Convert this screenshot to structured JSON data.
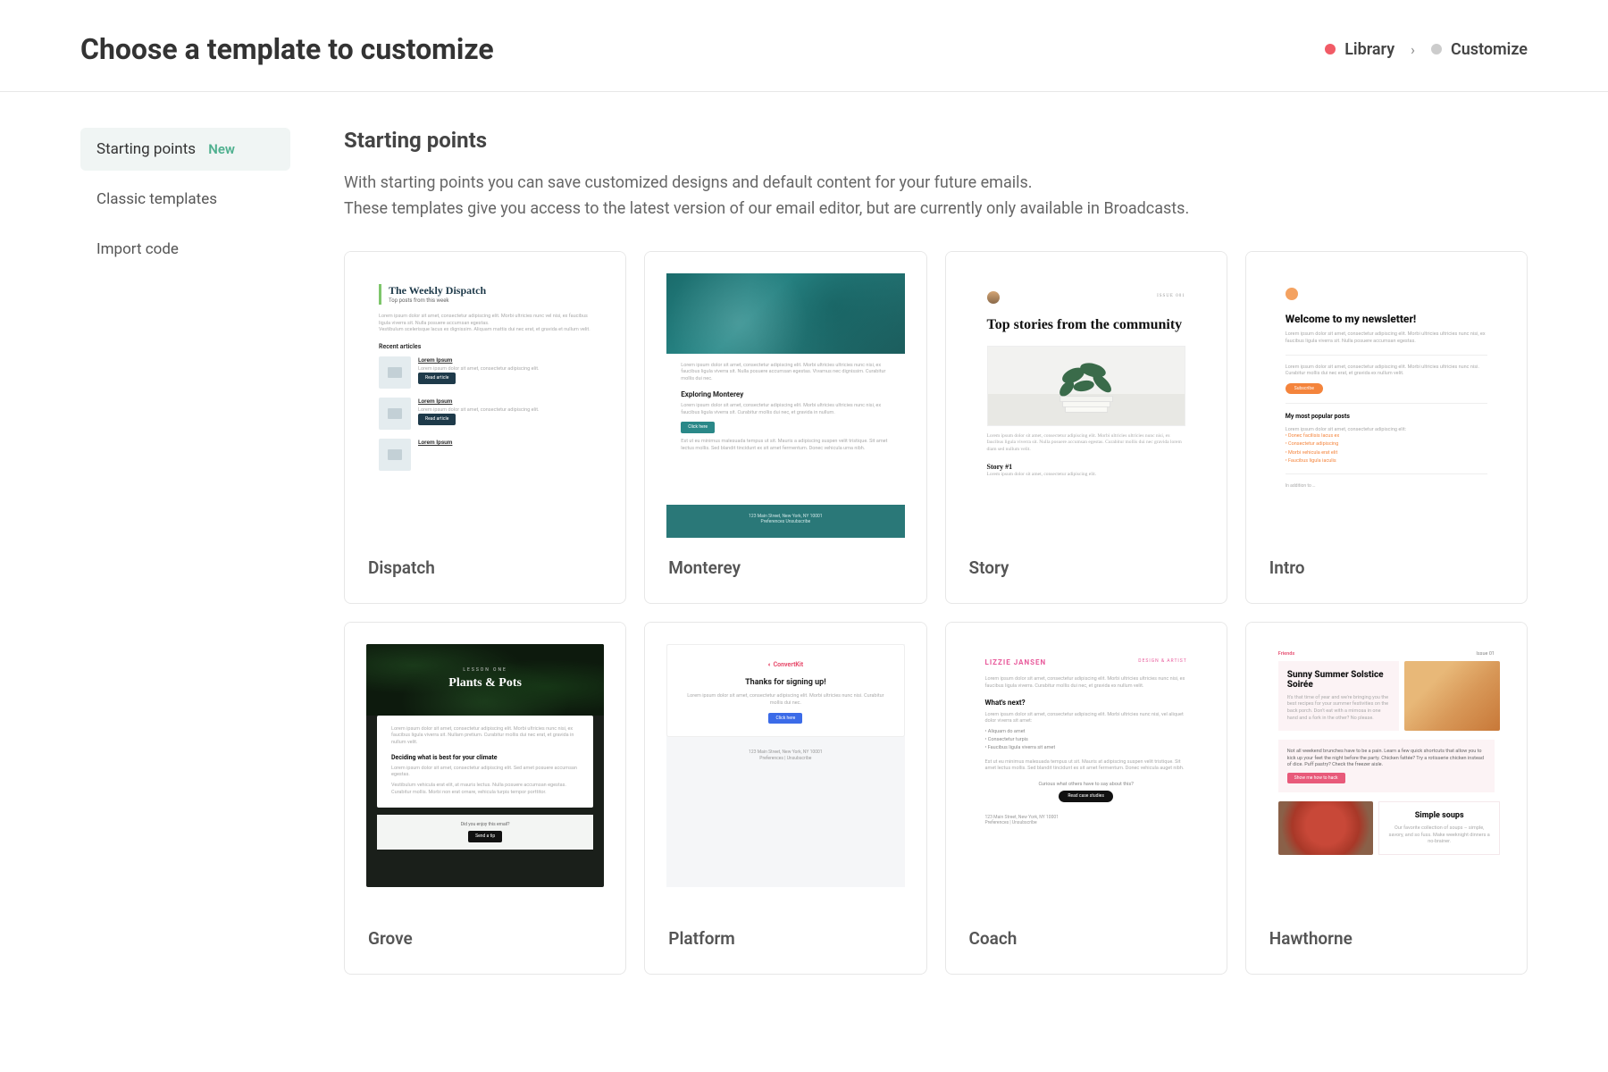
{
  "header": {
    "title": "Choose a template to customize",
    "breadcrumb": [
      {
        "label": "Library",
        "active": true
      },
      {
        "label": "Customize",
        "active": false
      }
    ]
  },
  "sidebar": {
    "items": [
      {
        "label": "Starting points",
        "badge": "New",
        "active": true
      },
      {
        "label": "Classic templates",
        "active": false
      },
      {
        "label": "Import code",
        "active": false
      }
    ]
  },
  "section": {
    "title": "Starting points",
    "desc_line1": "With starting points you can save customized designs and default content for your future emails.",
    "desc_line2": "These templates give you access to the latest version of our email editor, but are currently only available in Broadcasts."
  },
  "templates": [
    {
      "name": "Dispatch"
    },
    {
      "name": "Monterey"
    },
    {
      "name": "Story"
    },
    {
      "name": "Intro"
    },
    {
      "name": "Grove"
    },
    {
      "name": "Platform"
    },
    {
      "name": "Coach"
    },
    {
      "name": "Hawthorne"
    }
  ],
  "mock": {
    "dispatch": {
      "title": "The Weekly Dispatch",
      "subtitle": "Top posts from this week",
      "recent": "Recent articles",
      "item_title": "Lorem Ipsum",
      "read": "Read article"
    },
    "monterey": {
      "heading": "Exploring Monterey",
      "button": "Click here",
      "footer1": "123 Main Street, New York, NY 10001",
      "footer2": "Preferences    Unsubscribe"
    },
    "story": {
      "date": "ISSUE 001",
      "title": "Top stories from the community",
      "story1": "Story #1"
    },
    "intro": {
      "title": "Welcome to my newsletter!",
      "button": "Subscribe",
      "popular": "My most popular posts",
      "links": [
        "Donec facilisis lacus ex",
        "Consectetur adipiscing",
        "Morbi vehicula erat elit",
        "Faucibus ligula iaculis"
      ]
    },
    "grove": {
      "eyebrow": "LESSON ONE",
      "title": "Plants & Pots",
      "h2": "Deciding what is best for your climate",
      "foot": "Did you enjoy this email?",
      "button": "Send a tip"
    },
    "platform": {
      "logo": "ConvertKit",
      "title": "Thanks for signing up!",
      "button": "Click here",
      "foot1": "123 Main Street, New York, NY 10001",
      "foot2": "Preferences   |   Unsubscribe"
    },
    "coach": {
      "name": "LIZZIE JANSEN",
      "role": "DESIGN & ARTIST",
      "h2a": "What's next?",
      "bullets": [
        "Aliquam do amet",
        "Consectetur turpis",
        "Faucibus ligula viverra sit amet"
      ],
      "cta": "Curious what others have to say about this?",
      "button": "Read case studies",
      "foot1": "123 Main Street, New York, NY 10001",
      "foot2": "Preferences   |   Unsubscribe"
    },
    "hawthorne": {
      "brand": "Friends",
      "issue": "Issue 01",
      "h1": "Sunny Summer Solstice Soirée",
      "button": "Show me how to hack",
      "h2": "Simple soups"
    }
  }
}
